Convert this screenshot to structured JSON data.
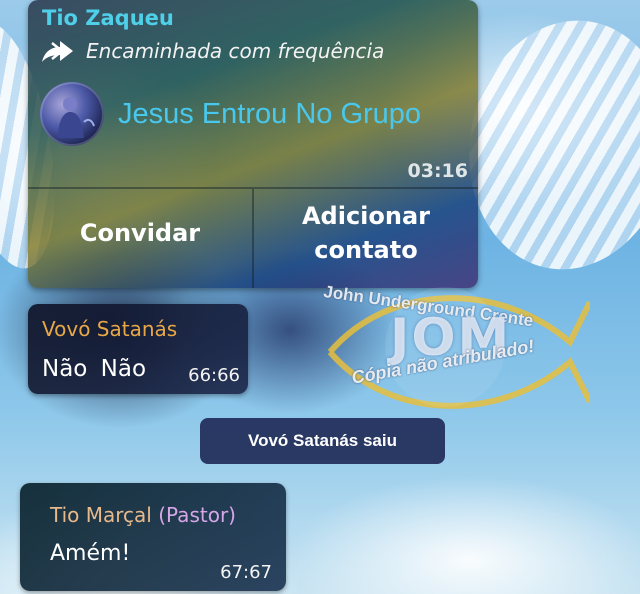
{
  "forwarded_card": {
    "sender": "Tio Zaqueu",
    "forwarded_label": "Encaminhada com frequência",
    "join_text": "Jesus Entrou No Grupo",
    "time": "03:16",
    "buttons": [
      "Convidar",
      "Adicionar contato"
    ],
    "icon": "forward-icon"
  },
  "messages": [
    {
      "sender": "Vovó Satanás",
      "text": "Não  Não",
      "time": "66:66"
    },
    {
      "sender": "Tio Marçal",
      "sender_role": "(Pastor)",
      "text": "Amém!",
      "time": "67:67"
    }
  ],
  "system_message": "Vovó Satanás saiu",
  "watermark": {
    "top_text": "John Underground Crente",
    "center_text": "JOM",
    "bottom_text": "Cópia não atribulado!"
  },
  "colors": {
    "sender_cyan": "#4fd0e8",
    "join_blue": "#49c8ee",
    "sender_orange": "#e9a846",
    "role_purple": "#d6a6e8"
  }
}
